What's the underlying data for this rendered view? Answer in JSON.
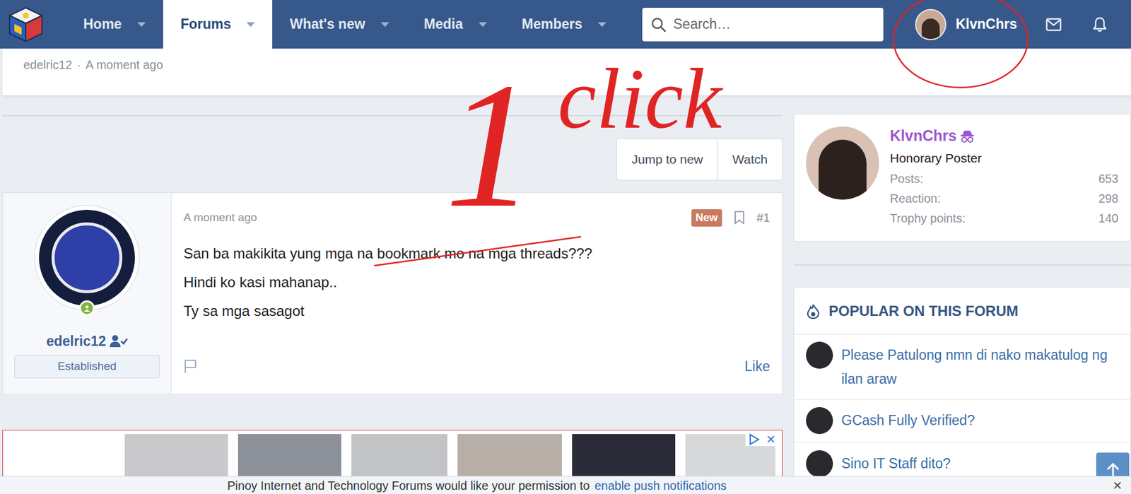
{
  "nav": {
    "items": [
      {
        "label": "Home",
        "selected": false
      },
      {
        "label": "Forums",
        "selected": true
      },
      {
        "label": "What's new",
        "selected": false
      },
      {
        "label": "Media",
        "selected": false
      },
      {
        "label": "Members",
        "selected": false
      }
    ],
    "search_placeholder": "Search…",
    "user": "KlvnChrs"
  },
  "prev_post": {
    "author": "edelric12",
    "separator": "·",
    "time": "A moment ago"
  },
  "thread_buttons": [
    {
      "label": "Jump to new"
    },
    {
      "label": "Watch"
    }
  ],
  "post": {
    "author": "edelric12",
    "online": true,
    "rank": "Established",
    "time": "A moment ago",
    "badge": "New",
    "number": "#1",
    "lines": [
      "San ba makikita yung mga na bookmark mo na mga threads???",
      "Hindi ko kasi mahanap..",
      "Ty sa mga sasagot"
    ],
    "like": "Like"
  },
  "ad": {
    "close": "✕"
  },
  "sidebar": {
    "user": {
      "name": "KlvnChrs",
      "title": "Honorary Poster",
      "stats": [
        {
          "label": "Posts:",
          "value": "653"
        },
        {
          "label": "Reaction:",
          "value": "298"
        },
        {
          "label": "Trophy points:",
          "value": "140"
        }
      ]
    },
    "popular": {
      "title": "POPULAR ON THIS FORUM",
      "items": [
        "Please Patulong nmn di nako makatulog ng ilan araw",
        "GCash Fully Verified?",
        "Sino IT Staff dito?"
      ]
    }
  },
  "notice": {
    "text": "Pinoy Internet and Technology Forums would like your permission to",
    "link": "enable push notifications",
    "close": "✕"
  },
  "annotations": {
    "number": "1",
    "word": "click"
  }
}
